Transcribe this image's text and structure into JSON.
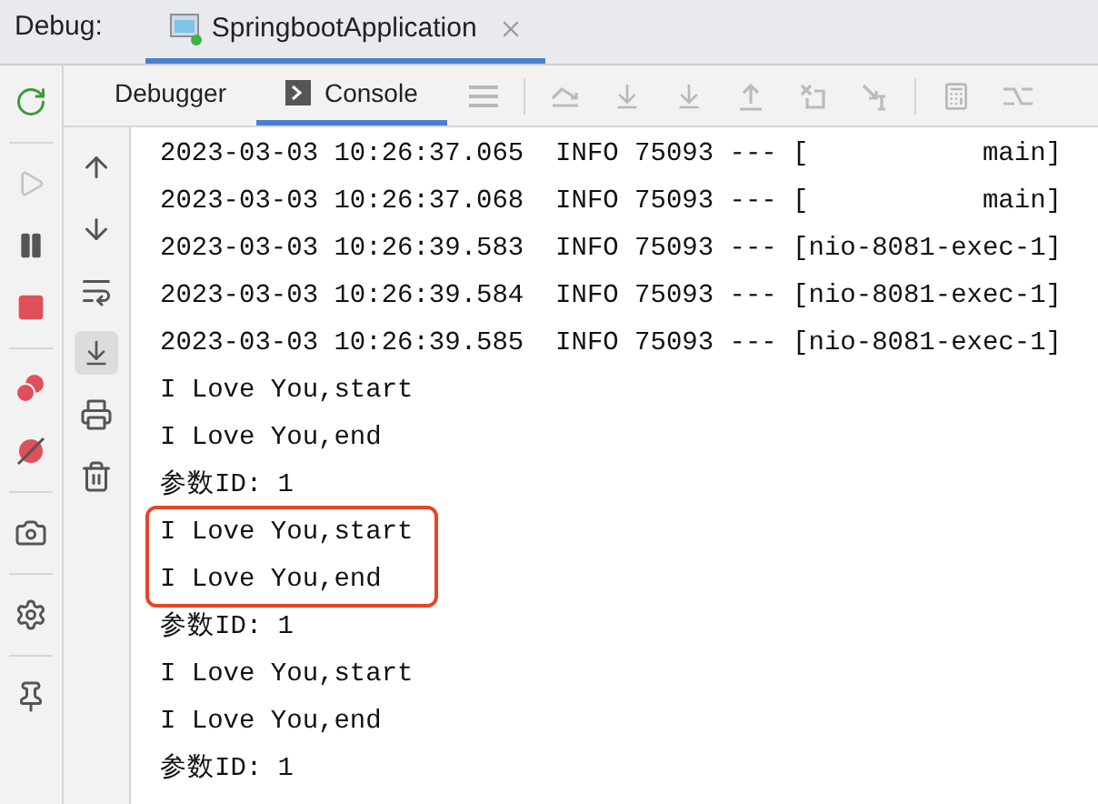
{
  "debug_bar": {
    "label": "Debug:",
    "session_tab": {
      "title": "SpringbootApplication",
      "selected": true
    }
  },
  "tabs": [
    {
      "label": "Debugger",
      "selected": false
    },
    {
      "label": "Console",
      "selected": true
    }
  ],
  "console": {
    "blocks": [
      {
        "kind": "plain",
        "lines": [
          "2023-03-03 10:26:37.065  INFO 75093 --- [           main]",
          "2023-03-03 10:26:37.068  INFO 75093 --- [           main]",
          "2023-03-03 10:26:39.583  INFO 75093 --- [nio-8081-exec-1]",
          "2023-03-03 10:26:39.584  INFO 75093 --- [nio-8081-exec-1]",
          "2023-03-03 10:26:39.585  INFO 75093 --- [nio-8081-exec-1]",
          "I Love You,start",
          "I Love You,end",
          "参数ID: 1"
        ]
      },
      {
        "kind": "boxed",
        "lines": [
          "I Love You,start",
          "I Love You,end"
        ]
      },
      {
        "kind": "plain",
        "lines": [
          "参数ID: 1",
          "I Love You,start",
          "I Love You,end",
          "参数ID: 1"
        ]
      }
    ]
  }
}
